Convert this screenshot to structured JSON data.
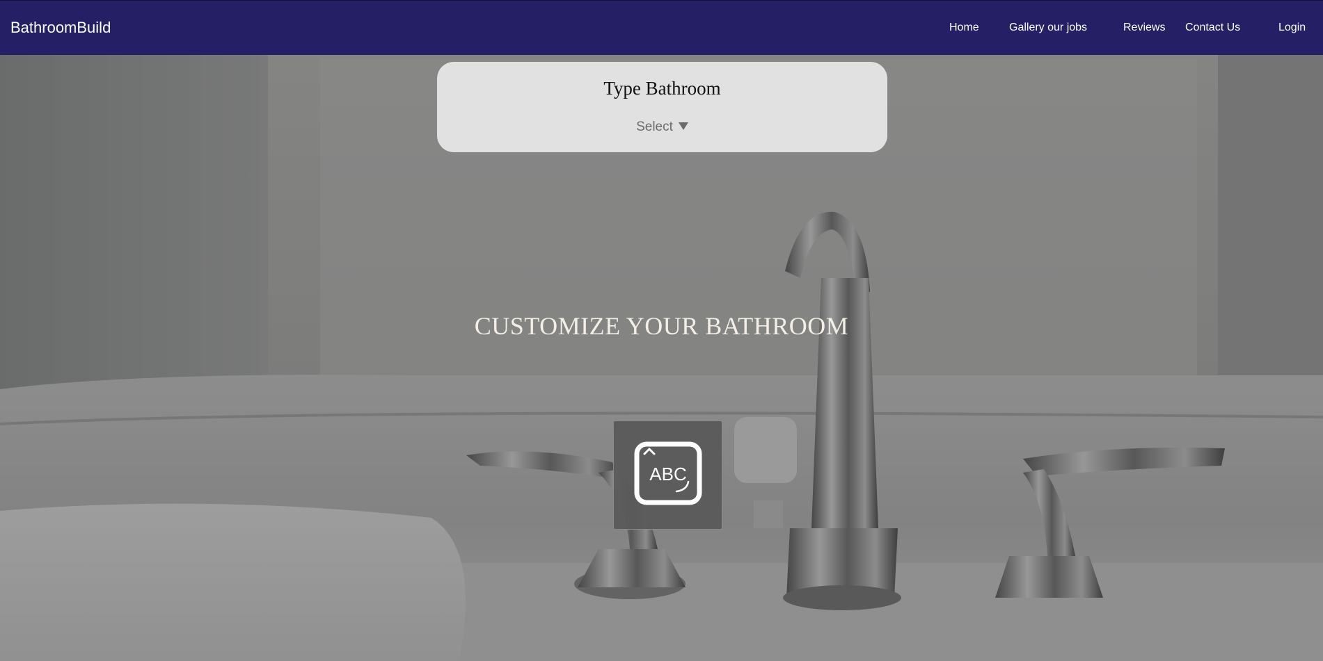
{
  "navbar": {
    "brand": "BathroomBuild",
    "links": [
      "Home",
      "Gallery our jobs",
      "Reviews",
      "Contact Us",
      "Login"
    ],
    "background_color": "#251f66"
  },
  "type_card": {
    "title": "Type Bathroom",
    "select_value": "Select"
  },
  "hero": {
    "heading": "CUSTOMIZE YOUR BATHROOM",
    "background": "bathtub-faucet-photo"
  },
  "input_button": {
    "icon": "keyboard-abc-icon",
    "icon_text": "ABC"
  }
}
